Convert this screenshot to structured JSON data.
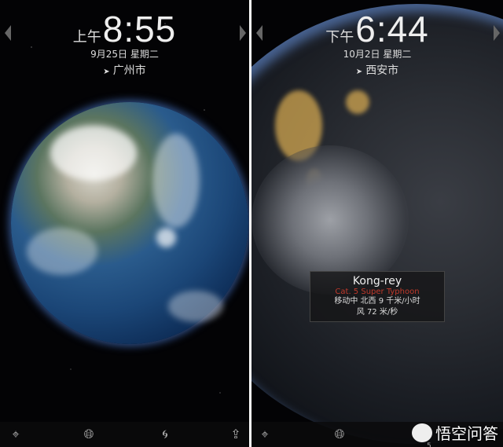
{
  "left_panel": {
    "ampm": "上午",
    "time": "8:55",
    "date": "9月25日 星期二",
    "city": "广州市"
  },
  "right_panel": {
    "ampm": "下午",
    "time": "6:44",
    "date": "10月2日 星期二",
    "city": "西安市",
    "storm": {
      "name": "Kong-rey",
      "category": "Cat. 5 Super Typhoon",
      "movement": "移动中 北西 9 千米/小时",
      "wind": "风 72 米/秒"
    }
  },
  "toolbar": {
    "icons": [
      "crosshair-icon",
      "globe-icon",
      "typhoon-icon",
      "share-icon"
    ],
    "storm_count": "5"
  },
  "watermark": {
    "text": "悟空问答"
  },
  "colors": {
    "storm_category": "#c0392b",
    "background": "#000000"
  }
}
